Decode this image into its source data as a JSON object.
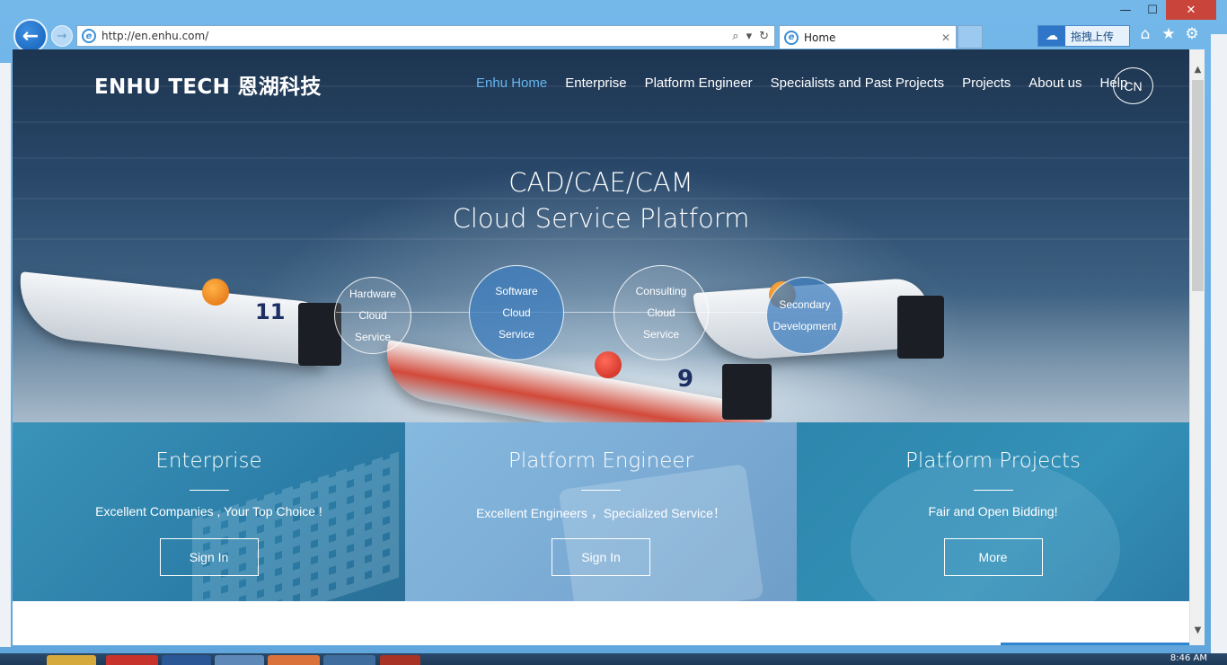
{
  "browser": {
    "url": "http://en.enhu.com/",
    "tab_title": "Home",
    "upload_label": "拖拽上传",
    "minimize_icon": "minimize-icon",
    "maximize_icon": "maximize-icon",
    "close_icon": "close-icon"
  },
  "site": {
    "logo": "ENHU TECH 恩湖科技",
    "nav": [
      {
        "label": "Enhu Home",
        "active": true
      },
      {
        "label": "Enterprise",
        "active": false
      },
      {
        "label": "Platform Engineer",
        "active": false
      },
      {
        "label": "Specialists and Past Projects",
        "active": false
      },
      {
        "label": "Projects",
        "active": false
      },
      {
        "label": "About us",
        "active": false
      },
      {
        "label": "Help",
        "active": false
      }
    ],
    "lang_button": "CN",
    "hero_title_line1": "CAD/CAE/CAM",
    "hero_title_line2": "Cloud Service Platform",
    "boat_numbers": [
      "11",
      "9"
    ],
    "services": [
      {
        "line1": "Hardware",
        "line2": "Cloud",
        "line3": "Service"
      },
      {
        "line1": "Software",
        "line2": "Cloud",
        "line3": "Service"
      },
      {
        "line1": "Consulting",
        "line2": "Cloud",
        "line3": "Service"
      },
      {
        "line1": "Secondary",
        "line2": "Development"
      }
    ],
    "panels": [
      {
        "title": "Enterprise",
        "text": "Excellent Companies , Your Top Choice !",
        "button": "Sign In"
      },
      {
        "title": "Platform Engineer",
        "text": "Excellent Engineers ，Specialized Service！",
        "button": "Sign In"
      },
      {
        "title": "Platform Projects",
        "text": "Fair and Open Bidding!",
        "button": "More"
      }
    ]
  },
  "colors": {
    "nav_active": "#67b7f0",
    "panel_1": "#2b7ea8",
    "panel_2": "#7aaad3",
    "panel_3": "#3491b7"
  },
  "taskbar": {
    "clock": "8:46 AM"
  }
}
